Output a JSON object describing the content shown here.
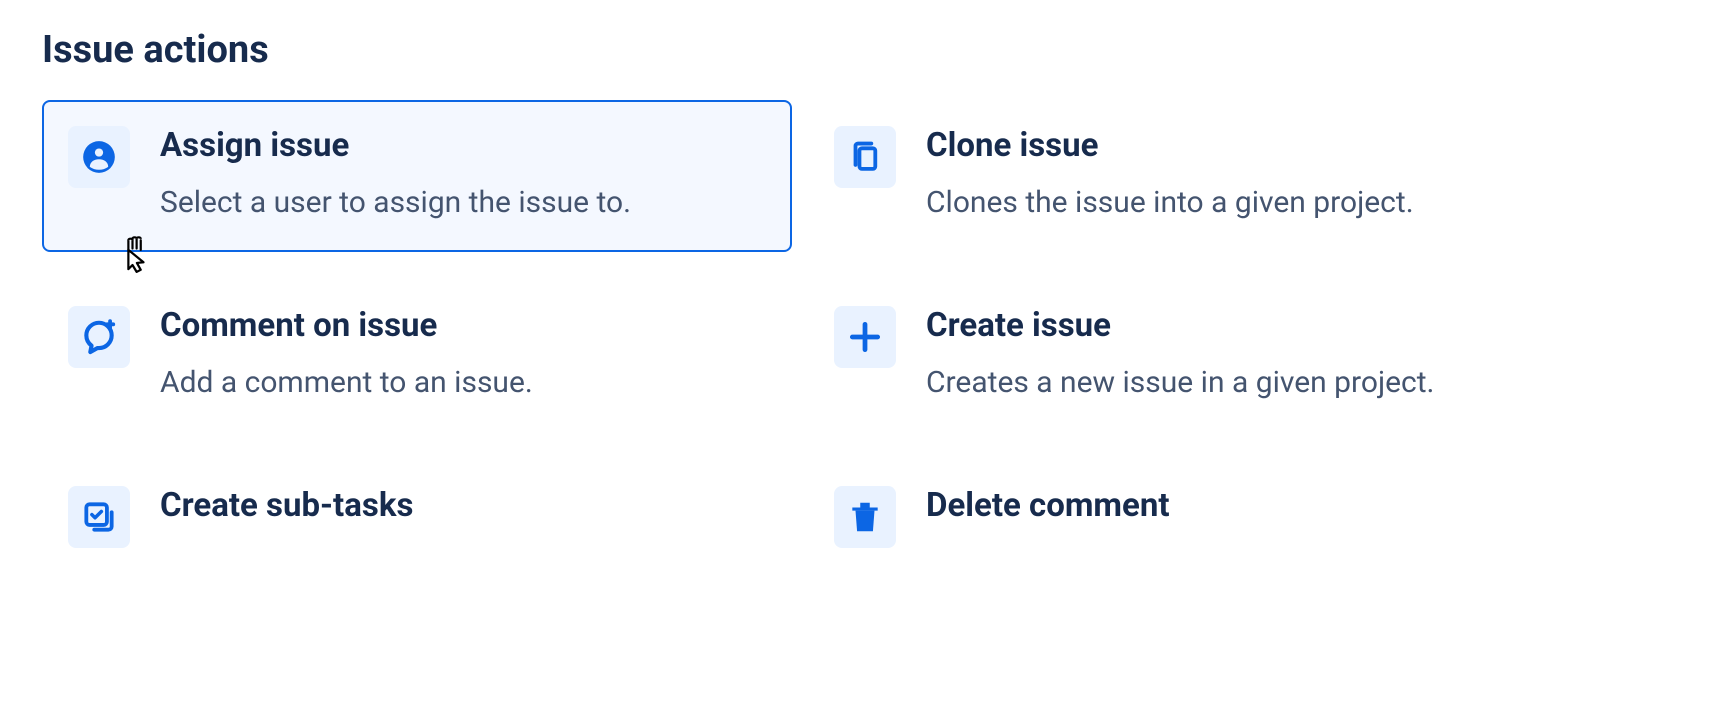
{
  "section": {
    "title": "Issue actions"
  },
  "actions": [
    {
      "title": "Assign issue",
      "description": "Select a user to assign the issue to.",
      "icon": "person-circle",
      "selected": true
    },
    {
      "title": "Clone issue",
      "description": "Clones the issue into a given project.",
      "icon": "copy",
      "selected": false
    },
    {
      "title": "Comment on issue",
      "description": "Add a comment to an issue.",
      "icon": "comment-add",
      "selected": false
    },
    {
      "title": "Create issue",
      "description": "Creates a new issue in a given project.",
      "icon": "plus",
      "selected": false
    },
    {
      "title": "Create sub-tasks",
      "description": "",
      "icon": "subtask",
      "selected": false
    },
    {
      "title": "Delete comment",
      "description": "",
      "icon": "trash",
      "selected": false
    }
  ],
  "colors": {
    "accent": "#0c66e4",
    "iconBg": "#e9f2ff",
    "textPrimary": "#172b4d",
    "textSecondary": "#44546f"
  }
}
